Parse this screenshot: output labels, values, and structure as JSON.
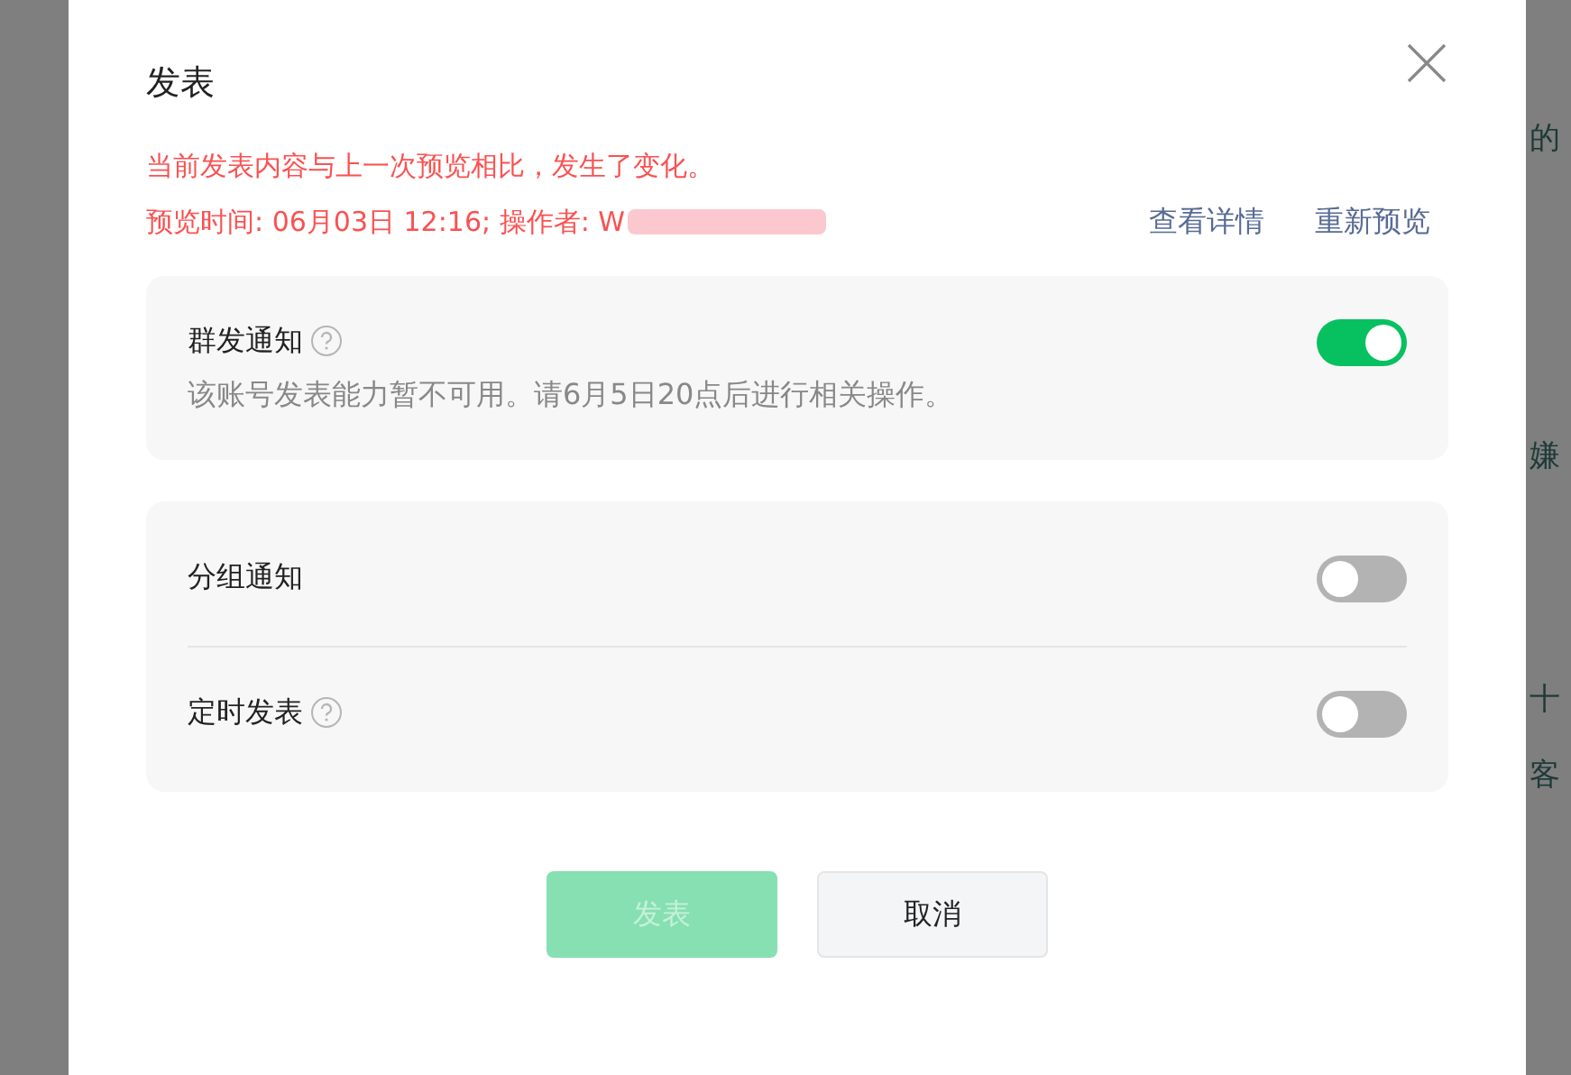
{
  "background_text": [
    "的",
    "嫌",
    "十",
    "客"
  ],
  "dialog": {
    "title": "发表",
    "warning": {
      "message": "当前发表内容与上一次预览相比，发生了变化。",
      "detail": "预览时间: 06月03日 12:16; 操作者: W"
    },
    "links": [
      "查看详情",
      "重新预览"
    ],
    "cards": [
      {
        "options": [
          {
            "label": "群发通知",
            "help": true,
            "on": true,
            "description": "该账号发表能力暂不可用。请6月5日20点后进行相关操作。"
          }
        ]
      },
      {
        "options": [
          {
            "label": "分组通知",
            "help": false,
            "on": false
          },
          {
            "label": "定时发表",
            "help": true,
            "on": false
          }
        ]
      }
    ],
    "buttons": [
      {
        "label": "发表",
        "kind": "primary",
        "disabled": true
      },
      {
        "label": "取消",
        "kind": "secondary",
        "disabled": false
      }
    ]
  }
}
